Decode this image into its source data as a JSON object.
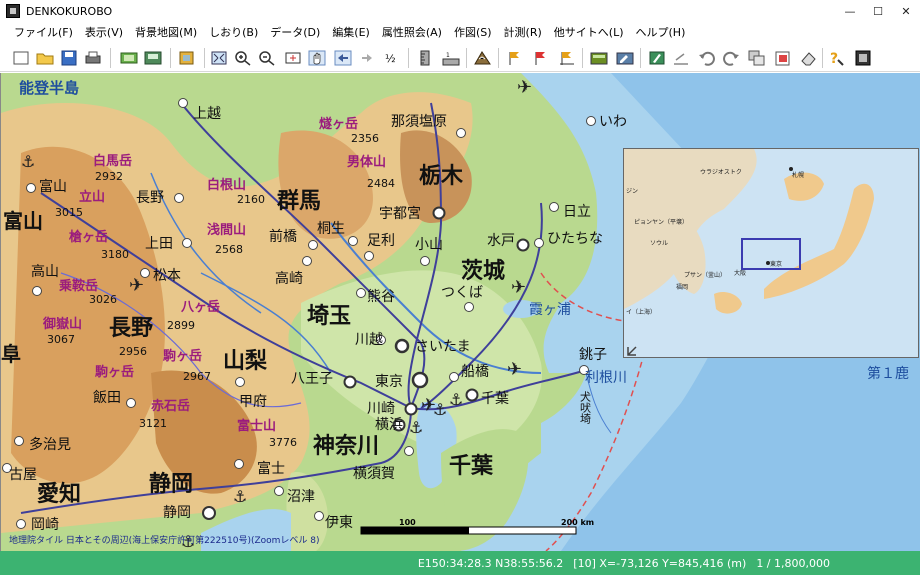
{
  "window": {
    "title": "DENKOKUROBO",
    "minimize": "—",
    "maximize": "☐",
    "close": "✕"
  },
  "menu": [
    {
      "label": "ファイル(F)"
    },
    {
      "label": "表示(V)"
    },
    {
      "label": "背景地図(M)"
    },
    {
      "label": "しおり(B)"
    },
    {
      "label": "データ(D)"
    },
    {
      "label": "編集(E)"
    },
    {
      "label": "属性照会(A)"
    },
    {
      "label": "作図(S)"
    },
    {
      "label": "計測(R)"
    },
    {
      "label": "他サイトへ(L)"
    },
    {
      "label": "ヘルプ(H)"
    }
  ],
  "map": {
    "prefectures": [
      {
        "id": "noto",
        "label": "能登半島"
      },
      {
        "id": "toyama",
        "label": "富山"
      },
      {
        "id": "gunma",
        "label": "群馬"
      },
      {
        "id": "tochigi",
        "label": "栃木"
      },
      {
        "id": "ibaraki",
        "label": "茨城"
      },
      {
        "id": "saitama",
        "label": "埼玉"
      },
      {
        "id": "nagano",
        "label": "長野"
      },
      {
        "id": "yamanashi",
        "label": "山梨"
      },
      {
        "id": "kanagawa",
        "label": "神奈川"
      },
      {
        "id": "chiba",
        "label": "千葉"
      },
      {
        "id": "shizuoka",
        "label": "静岡"
      },
      {
        "id": "aichi",
        "label": "愛知"
      },
      {
        "id": "gifu",
        "label": "阜"
      }
    ],
    "cities": [
      {
        "id": "joetsu",
        "label": "上越"
      },
      {
        "id": "nasushiobara",
        "label": "那須塩原"
      },
      {
        "id": "iwaki",
        "label": "いわ"
      },
      {
        "id": "nagaoka-toyama",
        "label": "富山"
      },
      {
        "id": "nagano-city",
        "label": "長野"
      },
      {
        "id": "utsunomiya",
        "label": "宇都宮"
      },
      {
        "id": "hitachi",
        "label": "日立"
      },
      {
        "id": "hitachinaka",
        "label": "ひたちな"
      },
      {
        "id": "kiryu",
        "label": "桐生"
      },
      {
        "id": "ueda",
        "label": "上田"
      },
      {
        "id": "maebashi",
        "label": "前橋"
      },
      {
        "id": "ashikaga",
        "label": "足利"
      },
      {
        "id": "oyama",
        "label": "小山"
      },
      {
        "id": "mito",
        "label": "水戸"
      },
      {
        "id": "takayama",
        "label": "高山"
      },
      {
        "id": "matsumoto",
        "label": "松本"
      },
      {
        "id": "takasaki",
        "label": "高崎"
      },
      {
        "id": "tsukuba",
        "label": "つくば"
      },
      {
        "id": "kumagaya",
        "label": "熊谷"
      },
      {
        "id": "kawagoe",
        "label": "川越"
      },
      {
        "id": "saitama-city",
        "label": "さいたま"
      },
      {
        "id": "choshi",
        "label": "銚子"
      },
      {
        "id": "hachioji",
        "label": "八王子"
      },
      {
        "id": "tokyo",
        "label": "東京"
      },
      {
        "id": "funabashi",
        "label": "船橋"
      },
      {
        "id": "iida",
        "label": "飯田"
      },
      {
        "id": "kofu",
        "label": "甲府"
      },
      {
        "id": "kawasaki",
        "label": "川崎"
      },
      {
        "id": "chiba-city",
        "label": "千葉"
      },
      {
        "id": "tajimi",
        "label": "多治見"
      },
      {
        "id": "yokohama",
        "label": "横浜"
      },
      {
        "id": "komaki",
        "label": "古屋"
      },
      {
        "id": "fuji",
        "label": "富士"
      },
      {
        "id": "yokosuka",
        "label": "横須賀"
      },
      {
        "id": "numazu",
        "label": "沼津"
      },
      {
        "id": "okazaki",
        "label": "岡崎"
      },
      {
        "id": "shizuoka-city",
        "label": "静岡"
      },
      {
        "id": "ito",
        "label": "伊東"
      }
    ],
    "mountains": [
      {
        "id": "hiuchi",
        "name": "燧ヶ岳",
        "elev": "2356"
      },
      {
        "id": "shirouma",
        "name": "白馬岳",
        "elev": "2932"
      },
      {
        "id": "nantai",
        "name": "男体山",
        "elev": "2484"
      },
      {
        "id": "tateyama",
        "name": "立山",
        "elev": "3015"
      },
      {
        "id": "kusatsu-shirane",
        "name": "白根山",
        "elev": "2160"
      },
      {
        "id": "asama",
        "name": "浅間山",
        "elev": "2568"
      },
      {
        "id": "yarigatake",
        "name": "槍ヶ岳",
        "elev": "3180"
      },
      {
        "id": "norikura",
        "name": "乗鞍岳",
        "elev": "3026"
      },
      {
        "id": "yatsugatake",
        "name": "八ヶ岳",
        "elev": "2899"
      },
      {
        "id": "ontake",
        "name": "御嶽山",
        "elev": "3067"
      },
      {
        "id": "komagatake-kiso",
        "name": "",
        "elev": "2956"
      },
      {
        "id": "komagatake",
        "name": "駒ヶ岳",
        "elev": "2967"
      },
      {
        "id": "ena",
        "name": "駒ヶ岳",
        "elev": ""
      },
      {
        "id": "akaishi",
        "name": "赤石岳",
        "elev": "3121"
      },
      {
        "id": "fujisan",
        "name": "富士山",
        "elev": "3776"
      }
    ],
    "water": [
      {
        "id": "kasumigaura",
        "label": "霞ヶ浦"
      },
      {
        "id": "tonegawa",
        "label": "利根川"
      },
      {
        "id": "inubosaki",
        "label": "犬吠埼"
      },
      {
        "id": "daiichi-kashima",
        "label": "第１鹿"
      }
    ],
    "scale": {
      "mid_label": "100",
      "end_label": "200 km"
    },
    "attribution": "地理院タイル 日本とその周辺(海上保安庁許可第222510号)(Zoomレベル 8)"
  },
  "inset": {
    "labels": [
      {
        "id": "vladivostok",
        "label": "ウラジオストク"
      },
      {
        "id": "sapporo",
        "label": "札幌"
      },
      {
        "id": "chongjin",
        "label": "ジン"
      },
      {
        "id": "pyongyang",
        "label": "ピョンヤン（平壌）"
      },
      {
        "id": "seoul",
        "label": "ソウル"
      },
      {
        "id": "busan",
        "label": "プサン（釜山）"
      },
      {
        "id": "fukuoka",
        "label": "福岡"
      },
      {
        "id": "osaka",
        "label": "大阪"
      },
      {
        "id": "tokyo",
        "label": "東京"
      },
      {
        "id": "shanghai",
        "label": "イ（上海）"
      }
    ]
  },
  "status": {
    "coords": "E150:34:28.3 N38:55:56.2",
    "xy": "[10] X=-73,126 Y=845,416 (m)",
    "scale": "1 / 1,800,000"
  },
  "colors": {
    "status_bg": "#3cb371",
    "sea": "#a9d3ee",
    "lowland": "#b9d98f",
    "mountain_purple": "#9b1c7d"
  }
}
